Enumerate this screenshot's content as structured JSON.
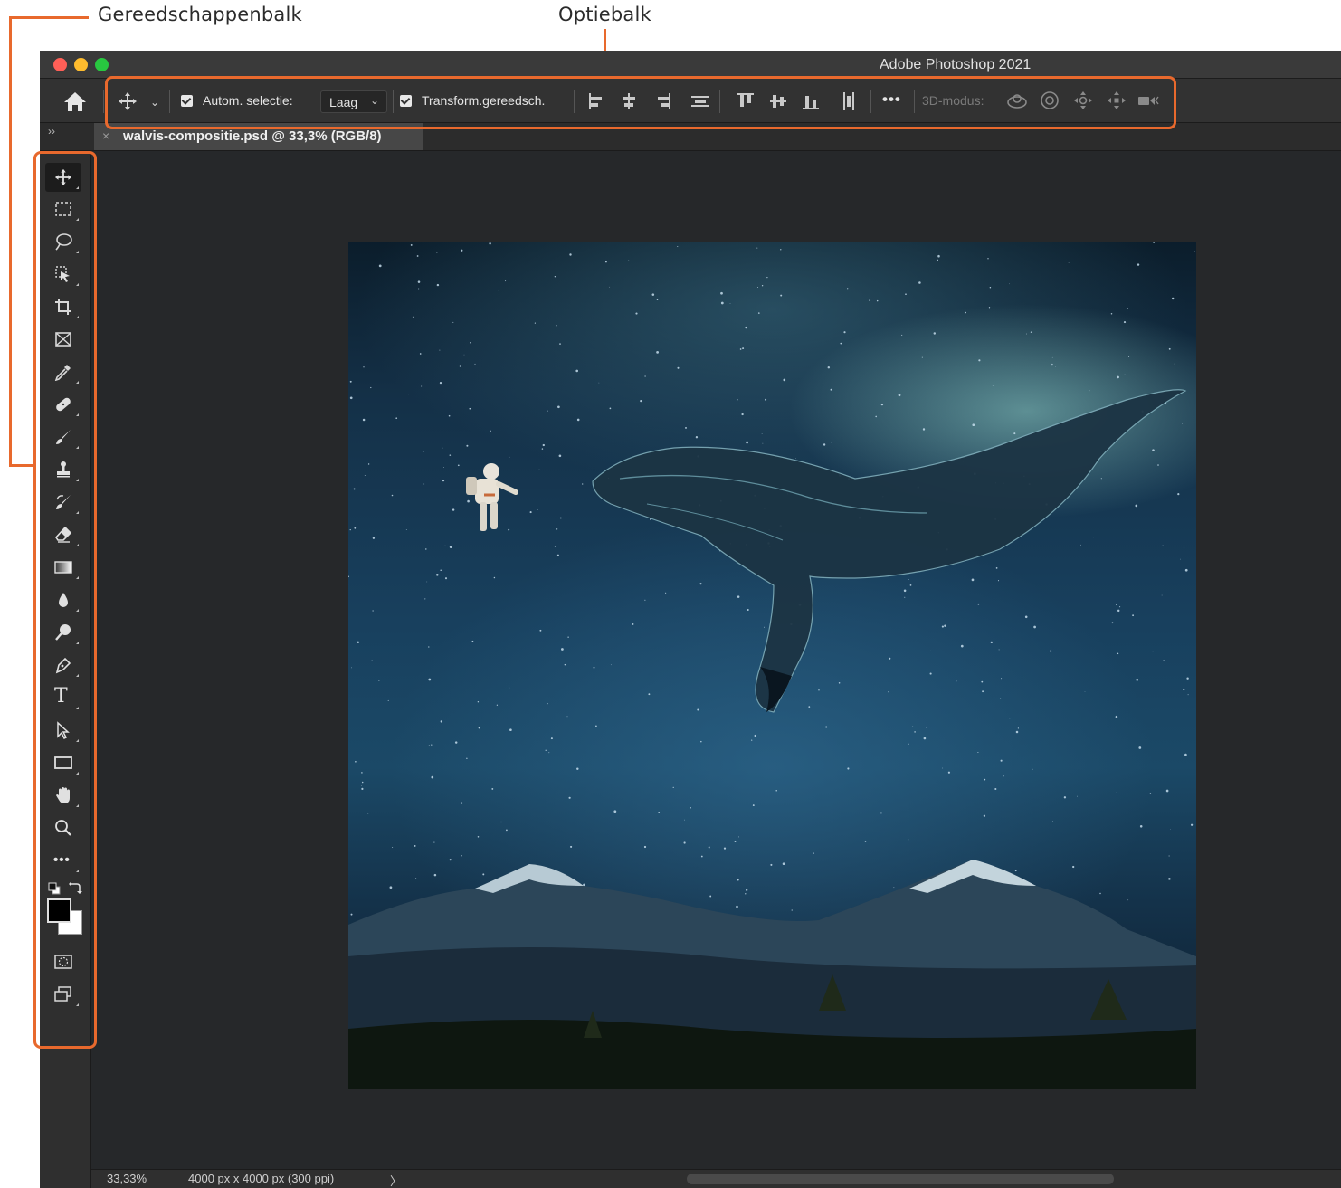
{
  "callouts": {
    "toolbar_label": "Gereedschappenbalk",
    "optionsbar_label": "Optiebalk"
  },
  "window": {
    "title": "Adobe Photoshop 2021"
  },
  "options_bar": {
    "auto_select_label": "Autom. selectie:",
    "auto_select_checked": true,
    "auto_select_target": "Laag",
    "transform_label": "Transform.gereedsch.",
    "transform_checked": true,
    "more_label": "•••",
    "mode_3d_label": "3D-modus:"
  },
  "document_tab": {
    "close_glyph": "×",
    "title": "walvis-compositie.psd @ 33,3% (RGB/8)"
  },
  "toolbar": {
    "collapse_glyph": "››",
    "tools": [
      {
        "name": "move-tool",
        "icon": "move-icon"
      },
      {
        "name": "rectangular-marquee-tool",
        "icon": "marquee-icon"
      },
      {
        "name": "lasso-tool",
        "icon": "lasso-icon"
      },
      {
        "name": "object-selection-tool",
        "icon": "object-selection-icon"
      },
      {
        "name": "crop-tool",
        "icon": "crop-icon"
      },
      {
        "name": "frame-tool",
        "icon": "frame-icon"
      },
      {
        "name": "eyedropper-tool",
        "icon": "eyedropper-icon"
      },
      {
        "name": "spot-healing-brush-tool",
        "icon": "bandage-icon"
      },
      {
        "name": "brush-tool",
        "icon": "brush-icon"
      },
      {
        "name": "clone-stamp-tool",
        "icon": "stamp-icon"
      },
      {
        "name": "history-brush-tool",
        "icon": "history-brush-icon"
      },
      {
        "name": "eraser-tool",
        "icon": "eraser-icon"
      },
      {
        "name": "gradient-tool",
        "icon": "gradient-icon"
      },
      {
        "name": "blur-tool",
        "icon": "drop-icon"
      },
      {
        "name": "dodge-tool",
        "icon": "dodge-icon"
      },
      {
        "name": "pen-tool",
        "icon": "pen-icon"
      },
      {
        "name": "type-tool",
        "icon": "type-icon"
      },
      {
        "name": "path-selection-tool",
        "icon": "arrow-icon"
      },
      {
        "name": "rectangle-tool",
        "icon": "rectangle-icon"
      },
      {
        "name": "hand-tool",
        "icon": "hand-icon"
      },
      {
        "name": "zoom-tool",
        "icon": "magnifier-icon"
      },
      {
        "name": "edit-toolbar",
        "icon": "ellipsis-icon"
      }
    ],
    "type_glyph": "T",
    "more_glyph": "•••",
    "foreground_color": "#000000",
    "background_color": "#ffffff"
  },
  "status_bar": {
    "zoom": "33,33%",
    "document_info": "4000 px x 4000 px (300 ppi)",
    "expand_glyph": "〉"
  },
  "colors": {
    "annotation": "#e8692d",
    "app_background": "#262626"
  }
}
